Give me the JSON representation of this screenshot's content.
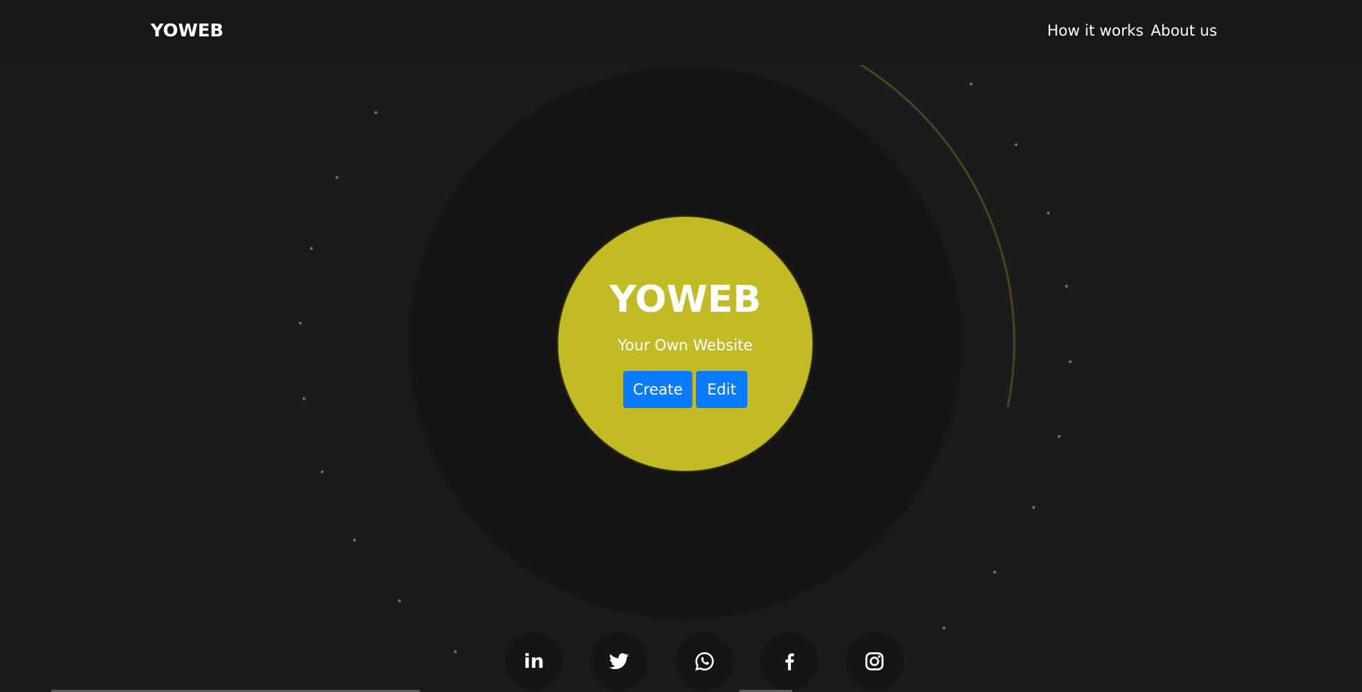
{
  "navbar": {
    "brand": "YOWEB",
    "links": [
      {
        "label": "How it works"
      },
      {
        "label": "About us"
      }
    ]
  },
  "hero": {
    "title": "YOWEB",
    "subtitle": "Your Own Website",
    "buttons": {
      "create_label": "Create",
      "edit_label": "Edit"
    }
  },
  "social": {
    "icons": [
      "linkedin-icon",
      "twitter-icon",
      "whatsapp-icon",
      "facebook-icon",
      "instagram-icon"
    ],
    "linkedin_glyph": "in"
  },
  "colors": {
    "background": "#1b1b1b",
    "navbar": "#181818",
    "disk": "#151515",
    "accent_yellow": "#c2bb24",
    "button_blue": "#0a7bff",
    "text": "#ffffff"
  }
}
